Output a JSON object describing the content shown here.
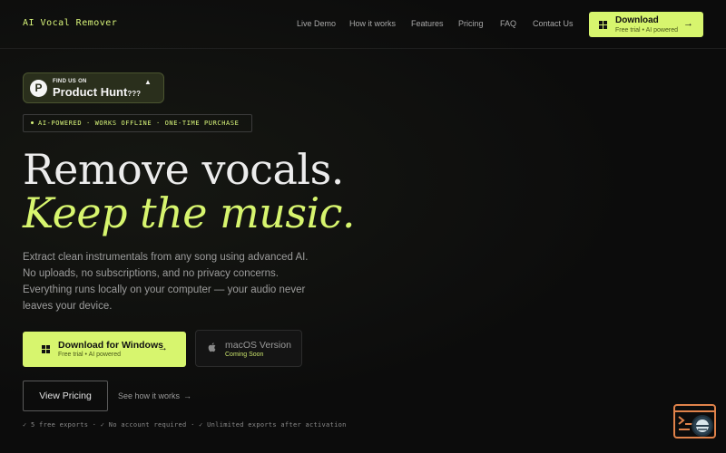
{
  "nav": {
    "logo": "AI Vocal Remover",
    "links": [
      "Live Demo",
      "How it works",
      "Features",
      "Pricing",
      "FAQ",
      "Contact Us"
    ],
    "download": {
      "label": "Download",
      "sub": "Free trial • AI powered",
      "arrow": "→",
      "icon": "windows-icon"
    }
  },
  "product_hunt": {
    "small": "FIND US ON",
    "big": "Product Hunt",
    "suffix": "???",
    "triangle": "▲",
    "letter": "P"
  },
  "badge": {
    "text": "AI-POWERED · WORKS OFFLINE · ONE-TIME PURCHASE"
  },
  "hero": {
    "line1": "Remove vocals.",
    "line2": "Keep the music.",
    "description": "Extract clean instrumentals from any song using advanced AI. No uploads, no subscriptions, and no privacy concerns. Everything runs locally on your computer — your audio never leaves your device."
  },
  "cta": {
    "windows": {
      "label": "Download for Windows",
      "sub": "Free trial • AI powered",
      "arrow": "→"
    },
    "mac": {
      "label": "macOS Version",
      "sub": "Coming Soon"
    },
    "pricing": "View Pricing",
    "how": {
      "label": "See how it works",
      "arrow": "→"
    }
  },
  "footnote": "✓ 5 free exports · ✓ No account required · ✓ Unlimited exports after activation",
  "colors": {
    "accent": "#d7f56e",
    "background": "#0c0c0c"
  }
}
